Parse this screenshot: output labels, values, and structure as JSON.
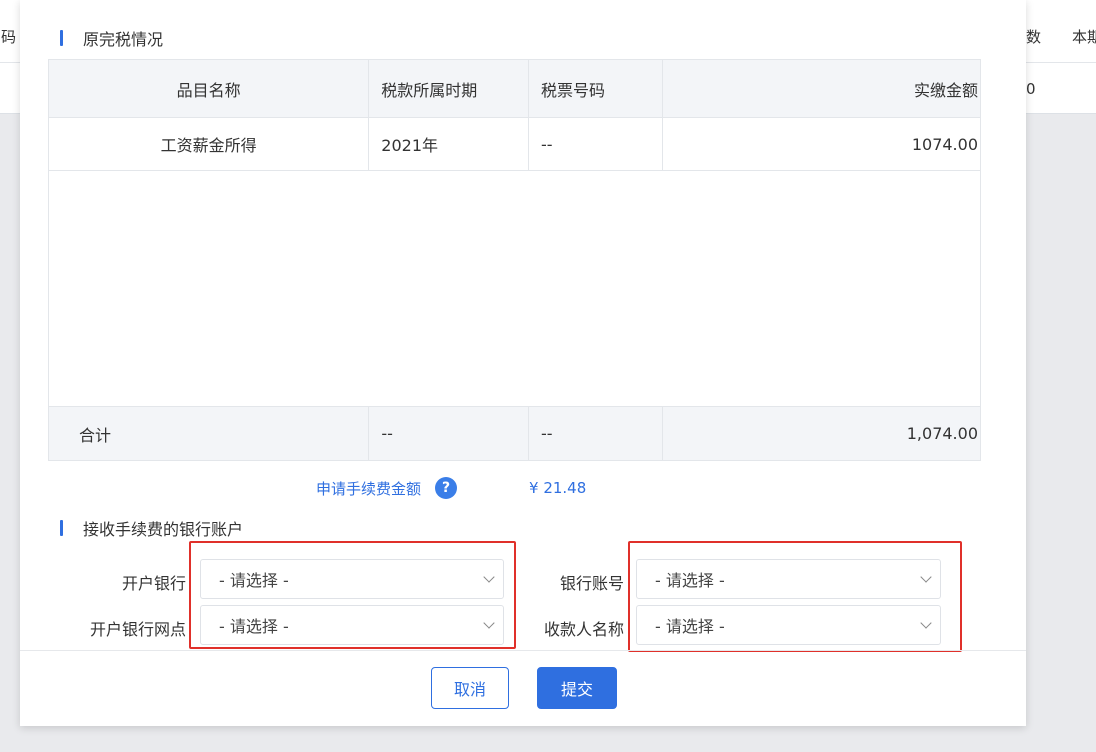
{
  "background": {
    "left_header_fragment": "号码",
    "right_header_fragment_1": "数",
    "right_header_fragment_2": "本期",
    "right_row_fragment": "0"
  },
  "section_original_tax": {
    "title": "原完税情况"
  },
  "table": {
    "headers": [
      "品目名称",
      "税款所属时期",
      "税票号码",
      "实缴金额"
    ],
    "rows": [
      [
        "工资薪金所得",
        "2021年",
        "--",
        "1074.00"
      ]
    ],
    "total": [
      "合计",
      "--",
      "--",
      "1,074.00"
    ]
  },
  "fee": {
    "label": "申请手续费金额",
    "help_icon_glyph": "?",
    "value": "¥ 21.48"
  },
  "section_bank": {
    "title": "接收手续费的银行账户"
  },
  "form": {
    "open_bank": {
      "label": "开户银行",
      "value": "- 请选择 -"
    },
    "bank_branch": {
      "label": "开户银行网点",
      "value": "- 请选择 -"
    },
    "bank_account": {
      "label": "银行账号",
      "value": "- 请选择 -"
    },
    "payee_name": {
      "label": "收款人名称",
      "value": "- 请选择 -"
    }
  },
  "buttons": {
    "cancel": "取消",
    "submit": "提交"
  },
  "colors": {
    "primary": "#2f6fe0",
    "highlight_box": "#e0302a"
  }
}
